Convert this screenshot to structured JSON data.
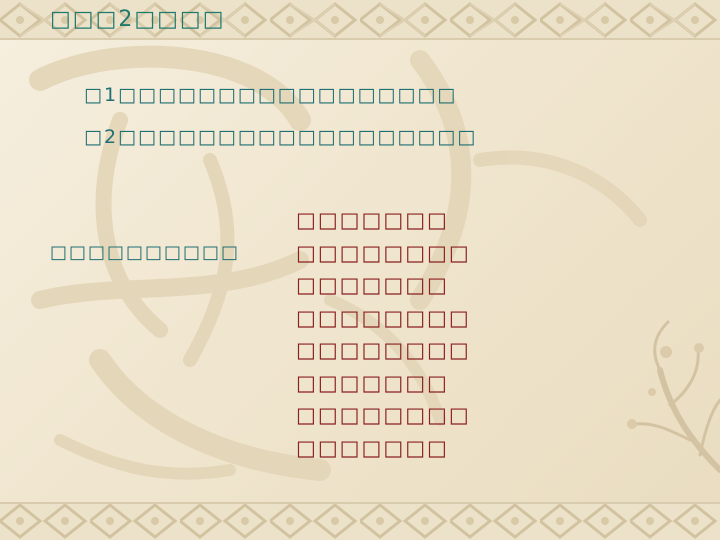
{
  "title": "□□□2□□□□",
  "questions": [
    "□1□□□□□□□□□□□□□□□□□",
    "□2□□□□□□□□□□□□□□□□□□"
  ],
  "left_label": "□□□□□□□□□□",
  "answers": [
    "□□□□□□□",
    "□□□□□□□□",
    "□□□□□□□",
    "□□□□□□□□",
    "□□□□□□□□",
    "□□□□□□□",
    "□□□□□□□□",
    "□□□□□□□"
  ],
  "colors": {
    "background": "#f3ead6",
    "title": "#1f7a6e",
    "question_text": "#1f6f73",
    "answer_text": "#8a2020",
    "border_pattern": "#cbb995"
  },
  "icons": [
    "decorative-border-pattern",
    "calligraphy-watermark",
    "plum-branch-decoration"
  ]
}
